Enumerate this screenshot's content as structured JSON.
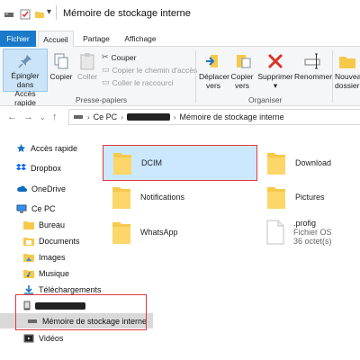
{
  "window": {
    "title": "Mémoire de stockage interne"
  },
  "ribbon_tabs": [
    "Fichier",
    "Accueil",
    "Partage",
    "Affichage"
  ],
  "ribbon": {
    "pin_label_1": "Épingler dans",
    "pin_label_2": "Accès rapide",
    "copy_label": "Copier",
    "paste_label": "Coller",
    "cut_label": "Couper",
    "copy_path_label": "Copier le chemin d'accès",
    "paste_shortcut_label": "Coller le raccourci",
    "clipboard_group": "Presse-papiers",
    "move_label_1": "Déplacer",
    "move_label_2": "vers",
    "copy_to_label_1": "Copier",
    "copy_to_label_2": "vers",
    "delete_label_1": "Supprimer",
    "rename_label": "Renommer",
    "organize_group": "Organiser",
    "new_folder_label_1": "Nouveau",
    "new_folder_label_2": "dossier"
  },
  "address": {
    "root": "Ce PC",
    "device": "",
    "current": "Mémoire de stockage interne"
  },
  "sidebar": {
    "items": [
      {
        "label": "Accès rapide",
        "icon": "star-icon"
      },
      {
        "label": "Dropbox",
        "icon": "dropbox-icon"
      },
      {
        "label": "OneDrive",
        "icon": "cloud-icon"
      },
      {
        "label": "Ce PC",
        "icon": "computer-icon"
      },
      {
        "label": "Bureau",
        "icon": "folder-icon"
      },
      {
        "label": "Documents",
        "icon": "documents-icon"
      },
      {
        "label": "Images",
        "icon": "images-icon"
      },
      {
        "label": "Musique",
        "icon": "music-icon"
      },
      {
        "label": "Téléchargements",
        "icon": "download-icon"
      },
      {
        "label": "",
        "icon": "phone-icon"
      },
      {
        "label": "Mémoire de stockage interne",
        "icon": "drive-icon"
      },
      {
        "label": "Vidéos",
        "icon": "video-icon"
      }
    ]
  },
  "content": {
    "items": [
      {
        "name": "DCIM",
        "type": "folder"
      },
      {
        "name": "Download",
        "type": "folder"
      },
      {
        "name": "Notifications",
        "type": "folder"
      },
      {
        "name": "Pictures",
        "type": "folder"
      },
      {
        "name": "WhatsApp",
        "type": "folder"
      },
      {
        "name": ".profig",
        "type": "file",
        "subtitle": "Fichier OS",
        "size": "36 octet(s)"
      }
    ]
  },
  "colors": {
    "file_tab": "#1979ca",
    "selection": "#cce8ff",
    "highlight_box": "#e0383f",
    "folder": "#f7c94b"
  }
}
